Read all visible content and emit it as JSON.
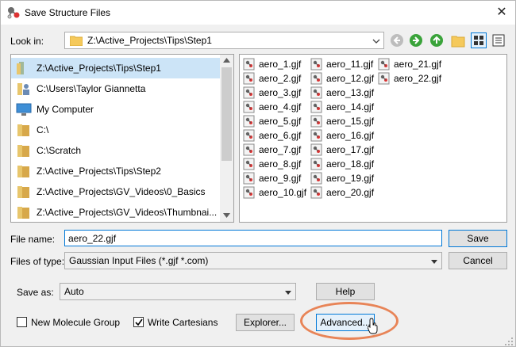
{
  "window": {
    "title": "Save Structure Files",
    "close_glyph": "✕"
  },
  "look_in": {
    "label": "Look in:",
    "path": "Z:\\Active_Projects\\Tips\\Step1"
  },
  "locations": [
    {
      "label": "Z:\\Active_Projects\\Tips\\Step1",
      "icon": "folder-icon",
      "selected": true
    },
    {
      "label": "C:\\Users\\Taylor Giannetta",
      "icon": "user-folder-icon"
    },
    {
      "label": "My Computer",
      "icon": "computer-icon"
    },
    {
      "label": "C:\\",
      "icon": "drive-icon"
    },
    {
      "label": "C:\\Scratch",
      "icon": "folder-icon"
    },
    {
      "label": "Z:\\Active_Projects\\Tips\\Step2",
      "icon": "folder-icon"
    },
    {
      "label": "Z:\\Active_Projects\\GV_Videos\\0_Basics",
      "icon": "folder-icon"
    },
    {
      "label": "Z:\\Active_Projects\\GV_Videos\\Thumbnai...",
      "icon": "folder-icon"
    }
  ],
  "files": [
    "aero_1.gjf",
    "aero_2.gjf",
    "aero_3.gjf",
    "aero_4.gjf",
    "aero_5.gjf",
    "aero_6.gjf",
    "aero_7.gjf",
    "aero_8.gjf",
    "aero_9.gjf",
    "aero_10.gjf",
    "aero_11.gjf",
    "aero_12.gjf",
    "aero_13.gjf",
    "aero_14.gjf",
    "aero_15.gjf",
    "aero_16.gjf",
    "aero_17.gjf",
    "aero_18.gjf",
    "aero_19.gjf",
    "aero_20.gjf",
    "aero_21.gjf",
    "aero_22.gjf"
  ],
  "file_name": {
    "label": "File name:",
    "value": "aero_22.gjf"
  },
  "file_type": {
    "label": "Files of type:",
    "value": "Gaussian Input Files (*.gjf *.com)"
  },
  "buttons": {
    "save": "Save",
    "cancel": "Cancel",
    "help": "Help",
    "explorer": "Explorer...",
    "advanced": "Advanced..."
  },
  "save_as": {
    "label": "Save as:",
    "value": "Auto"
  },
  "checkboxes": {
    "new_molecule_group": {
      "label": "New Molecule Group",
      "checked": false
    },
    "write_cartesians": {
      "label": "Write Cartesians",
      "checked": true
    }
  },
  "colors": {
    "highlight": "#e88457",
    "selection": "#cce4f7",
    "accent": "#0078d7"
  }
}
